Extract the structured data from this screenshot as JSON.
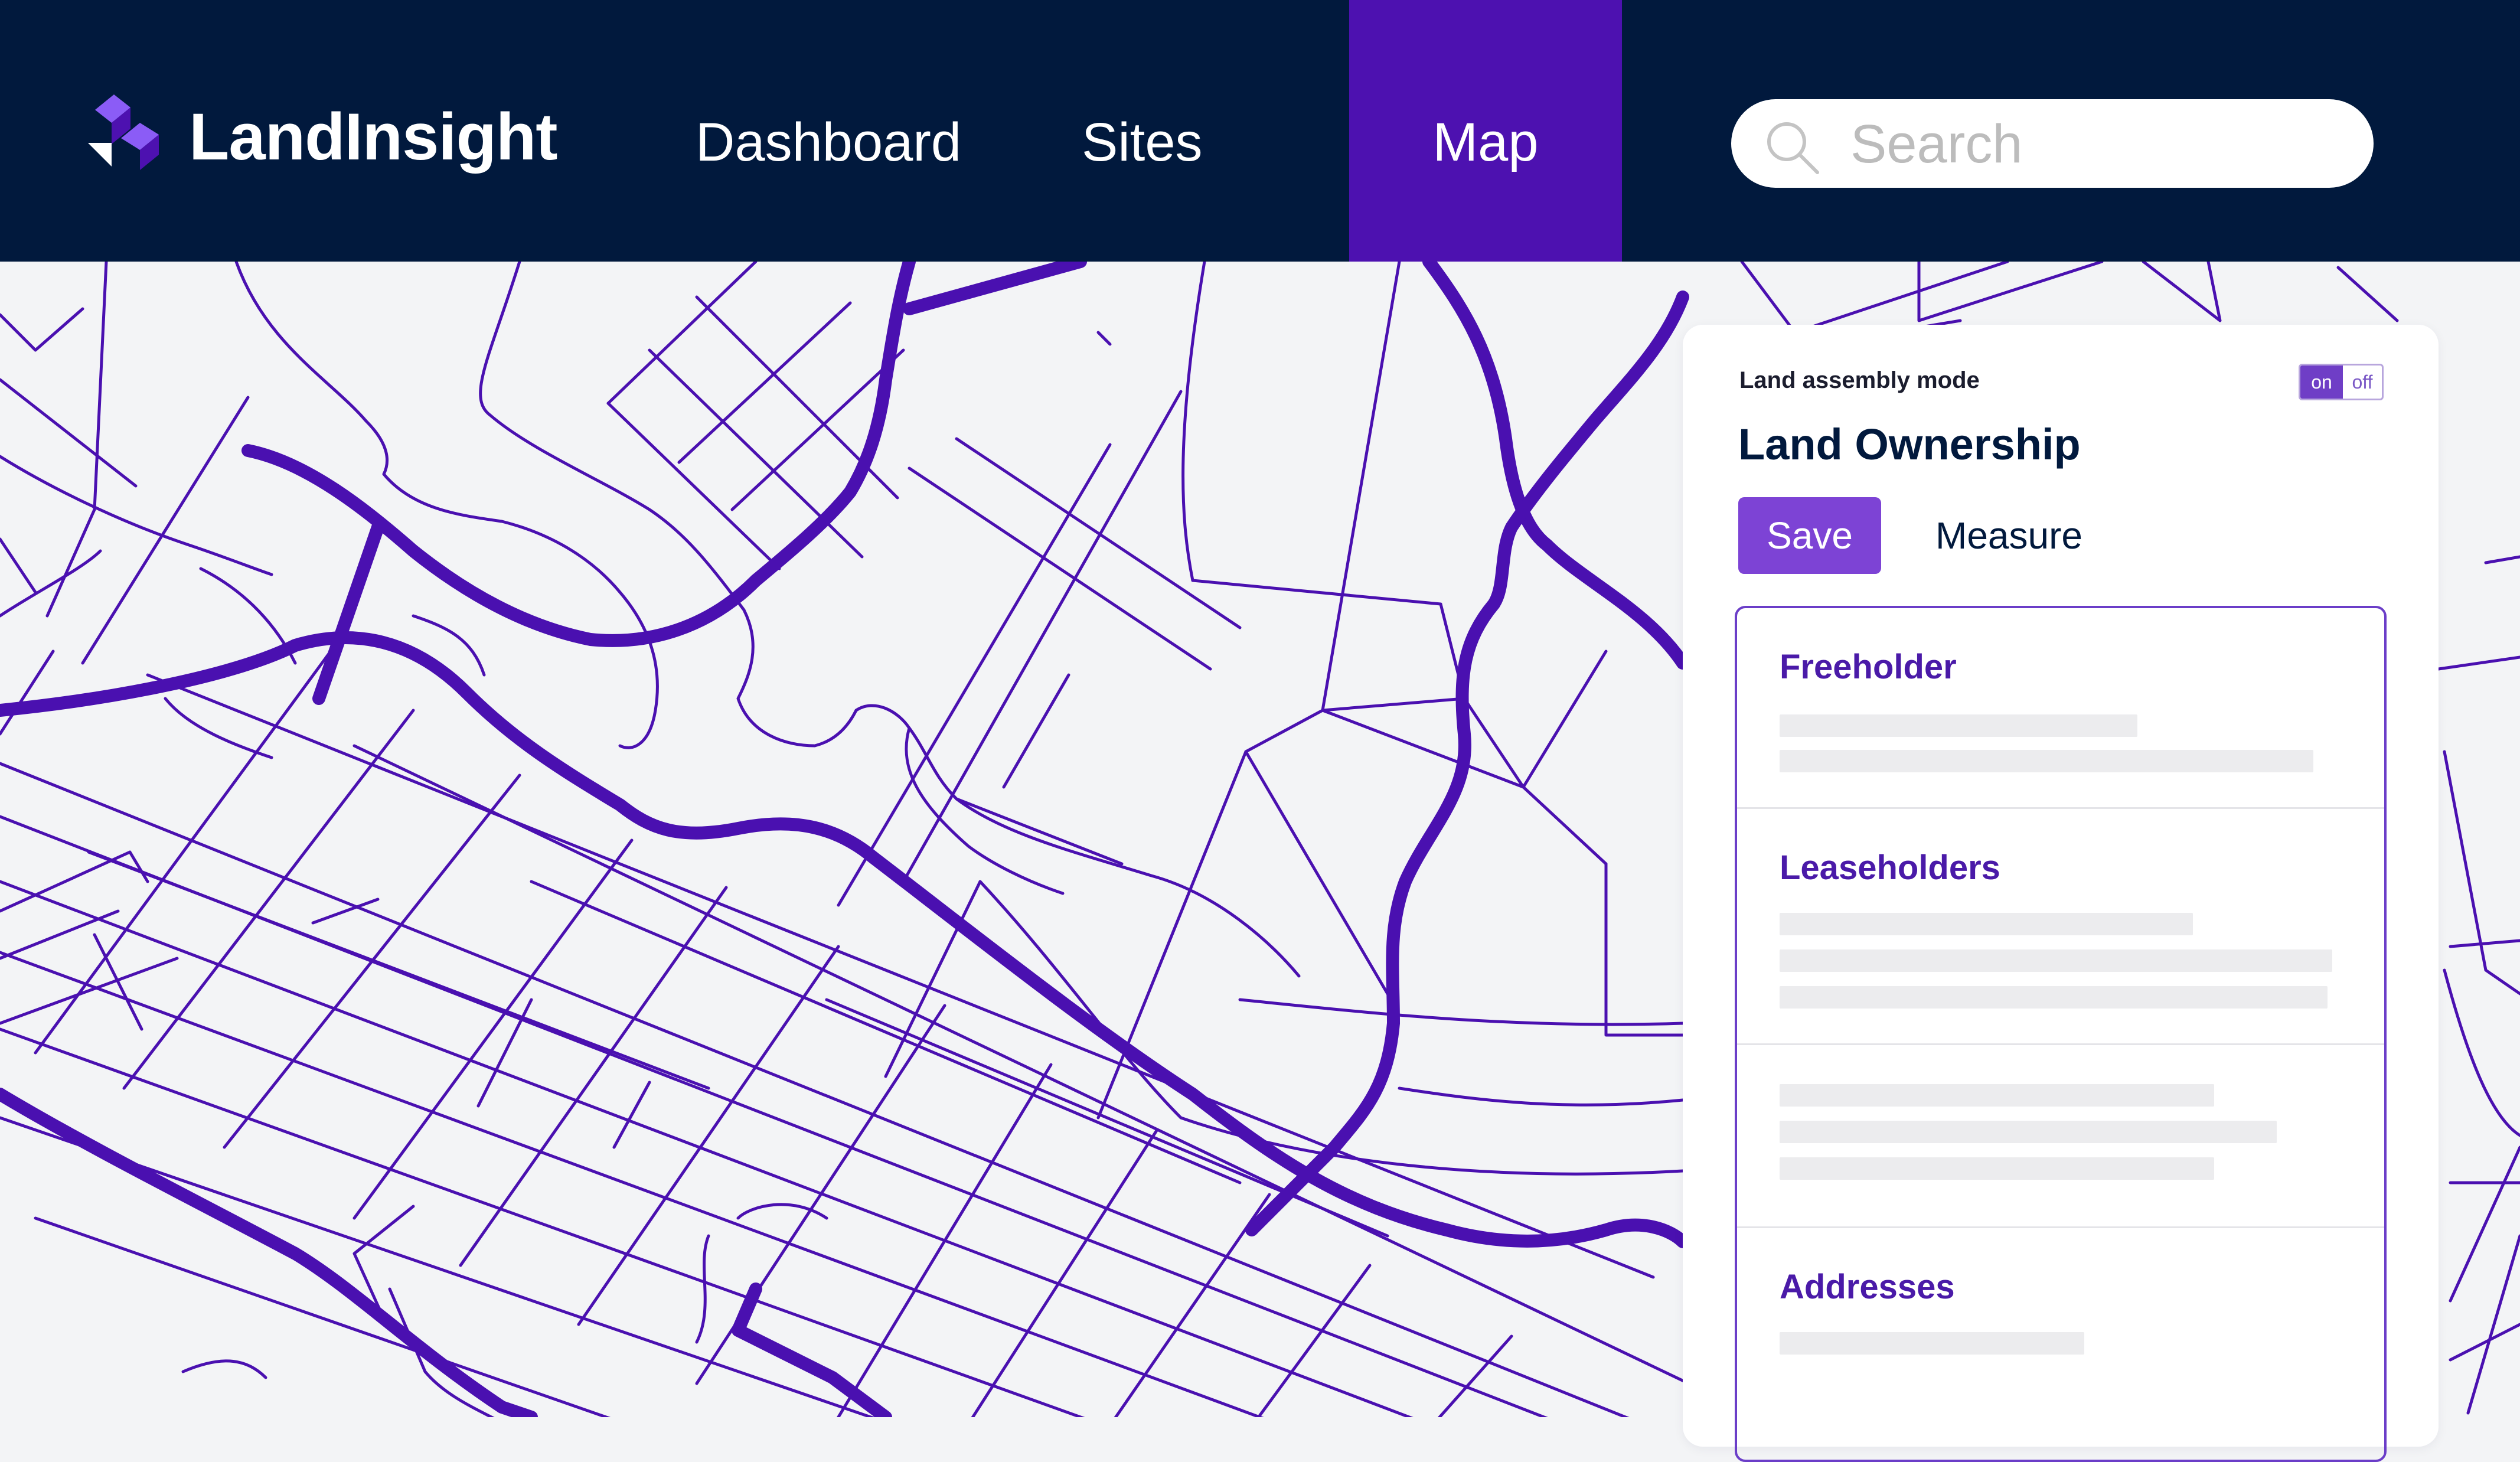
{
  "header": {
    "logo_text": "LandInsight",
    "logo_icon": "landinsight-logo-icon",
    "nav": [
      {
        "label": "Dashboard",
        "active": false
      },
      {
        "label": "Sites",
        "active": false
      },
      {
        "label": "Map",
        "active": true
      }
    ],
    "search": {
      "placeholder": "Search",
      "value": "",
      "icon": "search-icon"
    }
  },
  "panel": {
    "mode_label": "Land assembly mode",
    "toggle": {
      "on_label": "on",
      "off_label": "off",
      "state": "on"
    },
    "title": "Land Ownership",
    "save_label": "Save",
    "measure_label": "Measure",
    "sections": [
      {
        "title": "Freeholder"
      },
      {
        "title": "Leaseholders"
      },
      {
        "title": ""
      },
      {
        "title": "Addresses"
      }
    ]
  },
  "colors": {
    "header_bg": "#01193d",
    "accent": "#4d11b0",
    "button": "#7d43d5",
    "map_bg": "#f3f4f6",
    "road": "#4a10b0"
  }
}
